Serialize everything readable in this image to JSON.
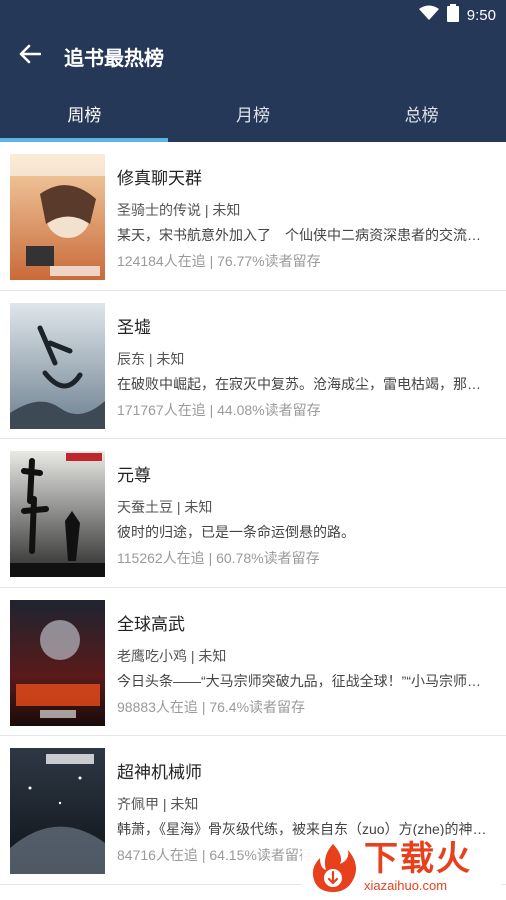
{
  "status_bar": {
    "time": "9:50",
    "icons": [
      "wifi-icon",
      "battery-icon"
    ]
  },
  "header": {
    "title": "追书最热榜",
    "back_icon": "arrow-left-icon"
  },
  "tabs": [
    {
      "label": "周榜",
      "active": true
    },
    {
      "label": "月榜",
      "active": false
    },
    {
      "label": "总榜",
      "active": false
    }
  ],
  "books": [
    {
      "title": "修真聊天群",
      "meta": "圣骑士的传说 | 未知",
      "desc": "某天，宋书航意外加入了　个仙侠中二病资深患者的交流群，里面的群友们都",
      "stats": "124184人在追 | 76.77%读者留存",
      "cover_color": "#d97a4a"
    },
    {
      "title": "圣墟",
      "meta": "辰东 | 未知",
      "desc": "在破败中崛起，在寂灭中复苏。沧海成尘，雷电枯竭，那一缕幽雾又一次临近",
      "stats": "171767人在追 | 44.08%读者留存",
      "cover_color": "#9fb0bd"
    },
    {
      "title": "元尊",
      "meta": "天蚕土豆 | 未知",
      "desc": "彼时的归途，已是一条命运倒悬的路。　",
      "stats": "115262人在追 | 60.78%读者留存",
      "cover_color": "#4a4a4a"
    },
    {
      "title": "全球高武",
      "meta": "老鹰吃小鸡 | 未知",
      "desc": "今日头条——“大马宗师突破九品，征战全球！”“小马宗师战死异域！”",
      "stats": "98883人在追 | 76.4%读者留存",
      "cover_color": "#7a1e1e"
    },
    {
      "title": "超神机械师",
      "meta": "齐佩甲 | 未知",
      "desc": "韩萧，《星海》骨灰级代练，被来自东（zuo）方(zhe)的神秘力量扔进了",
      "stats": "84716人在追 | 64.15%读者留存",
      "cover_color": "#2b3440"
    }
  ],
  "watermark": {
    "cn": "下载火",
    "en": "xiazaihuo.com"
  }
}
